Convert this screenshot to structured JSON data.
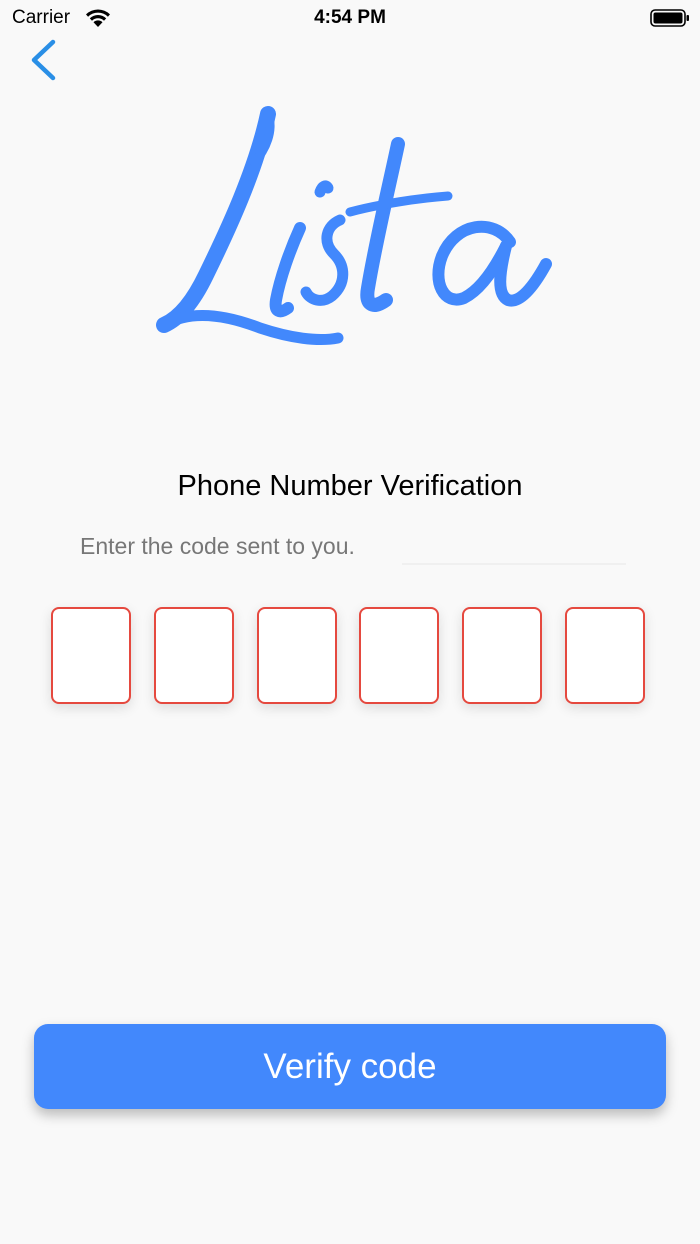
{
  "status_bar": {
    "carrier": "Carrier",
    "time": "4:54 PM",
    "wifi_icon": "wifi-icon",
    "battery_icon": "battery-icon"
  },
  "nav": {
    "back_icon": "chevron-left-icon"
  },
  "logo": {
    "text": "Lista",
    "color": "#4288fc"
  },
  "verification": {
    "title": "Phone Number Verification",
    "subtitle": "Enter the code sent to you.",
    "code_digits": [
      "",
      "",
      "",
      "",
      "",
      ""
    ]
  },
  "actions": {
    "verify_label": "Verify code"
  },
  "colors": {
    "accent": "#4288fc",
    "error_border": "#e5493f",
    "back_icon": "#2a8fe6"
  }
}
